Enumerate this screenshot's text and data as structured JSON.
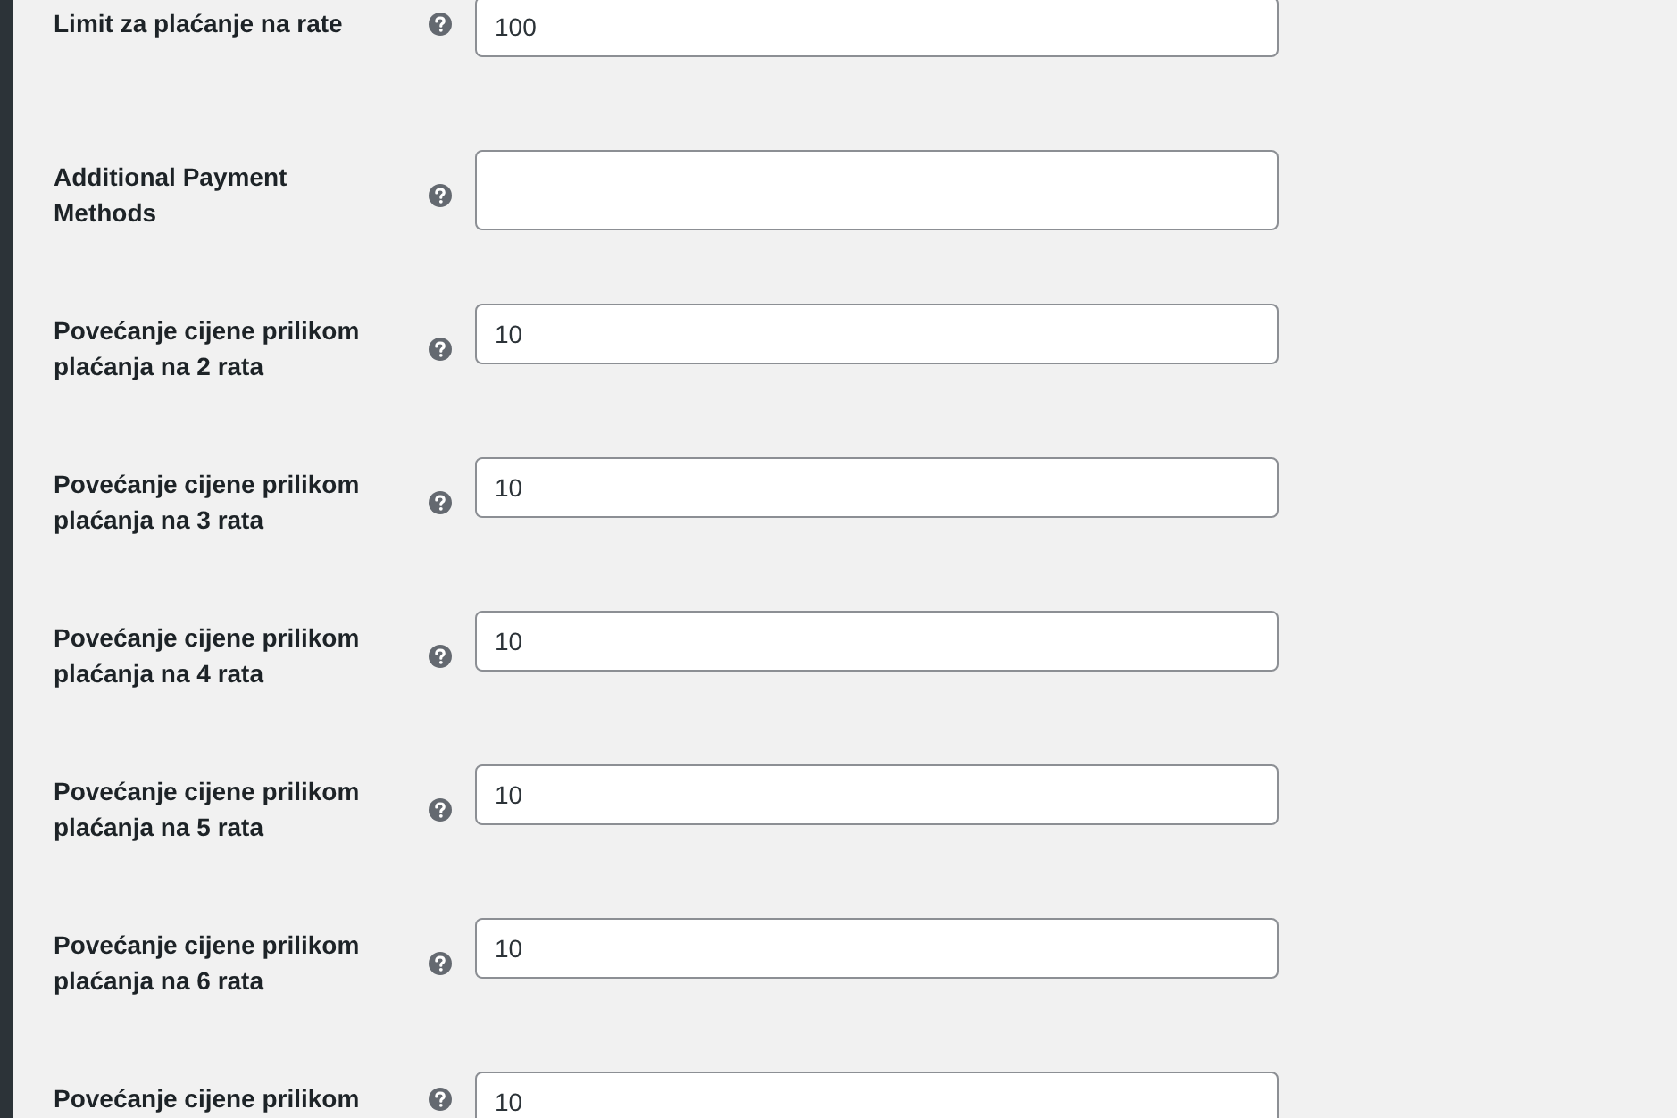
{
  "settings": [
    {
      "label": "Limit za plaćanje na rate",
      "kind": "text",
      "value": "100"
    },
    {
      "label": "Additional Payment Methods",
      "kind": "multiselect"
    },
    {
      "label": "Povećanje cijene prilikom plaćanja na 2 rata",
      "kind": "text",
      "value": "10"
    },
    {
      "label": "Povećanje cijene prilikom plaćanja na 3 rata",
      "kind": "text",
      "value": "10"
    },
    {
      "label": "Povećanje cijene prilikom plaćanja na 4 rata",
      "kind": "text",
      "value": "10"
    },
    {
      "label": "Povećanje cijene prilikom plaćanja na 5 rata",
      "kind": "text",
      "value": "10"
    },
    {
      "label": "Povećanje cijene prilikom plaćanja na 6 rata",
      "kind": "text",
      "value": "10"
    },
    {
      "label": "Povećanje cijene prilikom",
      "kind": "text",
      "value": "10"
    }
  ]
}
